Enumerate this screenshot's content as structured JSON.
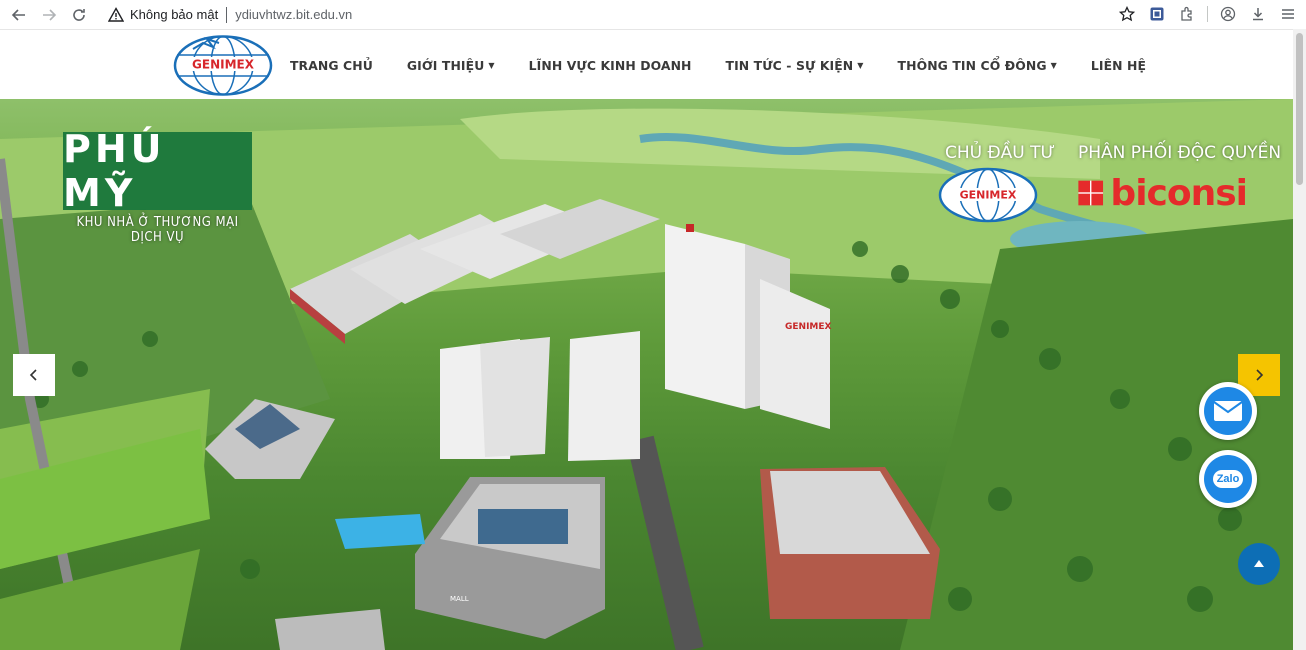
{
  "browser": {
    "security_label": "Không bảo mật",
    "url": "ydiuvhtwz.bit.edu.vn"
  },
  "site": {
    "logo_text": "GENIMEX",
    "menu": [
      {
        "label": "TRANG CHỦ",
        "has_dropdown": false
      },
      {
        "label": "GIỚI THIỆU",
        "has_dropdown": true
      },
      {
        "label": "LĨNH VỰC KINH DOANH",
        "has_dropdown": false
      },
      {
        "label": "TIN TỨC - SỰ KIỆN",
        "has_dropdown": true
      },
      {
        "label": "THÔNG TIN CỔ ĐÔNG",
        "has_dropdown": true
      },
      {
        "label": "LIÊN HỆ",
        "has_dropdown": false
      }
    ]
  },
  "hero": {
    "brand_name": "PHÚ MỸ",
    "brand_sub": "KHU NHÀ Ở THƯƠNG MẠI DỊCH VỤ",
    "investor_label": "CHỦ ĐẦU TƯ",
    "investor_logo_text": "GENIMEX",
    "distributor_label": "PHÂN PHỐI ĐỘC QUYỀN",
    "distributor_name": "biconsi",
    "building_sign": "GENIMEX",
    "mall_sign": "MALL"
  },
  "floating": {
    "zalo_label": "Zalo"
  },
  "colors": {
    "brand_green": "#1f7a3d",
    "accent_yellow": "#f5c400",
    "biconsi_red": "#e52b2b",
    "contact_blue": "#1e88e5",
    "top_button_blue": "#0d6eb5"
  }
}
